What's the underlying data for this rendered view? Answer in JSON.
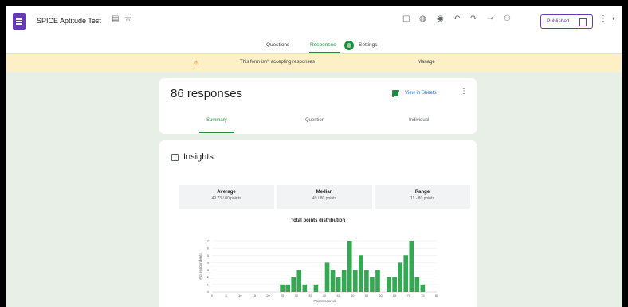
{
  "app": {
    "title": "SPICE Aptitude Test",
    "publish_label": "Published"
  },
  "tabs": [
    {
      "label": "Questions"
    },
    {
      "label": "Responses"
    },
    {
      "label": "Settings"
    }
  ],
  "banner": {
    "text": "This form isn't accepting responses",
    "action": "Manage"
  },
  "summary": {
    "responses_label": "86 responses",
    "view_in_sheets": "View in Sheets",
    "subtabs": [
      "Summary",
      "Question",
      "Individual"
    ]
  },
  "insights": {
    "title": "Insights",
    "stats": [
      {
        "label": "Average",
        "value": "49.73 / 80 points"
      },
      {
        "label": "Median",
        "value": "49 / 80 points"
      },
      {
        "label": "Range",
        "value": "11 - 80 points"
      }
    ]
  },
  "chart_data": {
    "type": "bar",
    "title": "Total points distribution",
    "xlabel": "Points scored",
    "ylabel": "# of respondents",
    "xlim": [
      0,
      80
    ],
    "ylim": [
      0,
      7
    ],
    "x": [
      25,
      27,
      29,
      31,
      33,
      35,
      37,
      39,
      41,
      43,
      45,
      47,
      49,
      51,
      53,
      55,
      57,
      59,
      61,
      63,
      65,
      67,
      69,
      71,
      73,
      75
    ],
    "values": [
      1,
      1,
      2,
      3,
      1,
      0,
      1,
      0,
      4,
      3,
      2,
      3,
      7,
      3,
      5,
      3,
      2,
      3,
      0,
      2,
      2,
      4,
      5,
      7,
      2,
      1
    ],
    "xticks": [
      0,
      5,
      10,
      15,
      20,
      25,
      30,
      35,
      40,
      45,
      50,
      55,
      60,
      65,
      70,
      75,
      80
    ],
    "yticks": [
      0,
      1,
      2,
      3,
      4,
      5,
      6,
      7
    ]
  }
}
